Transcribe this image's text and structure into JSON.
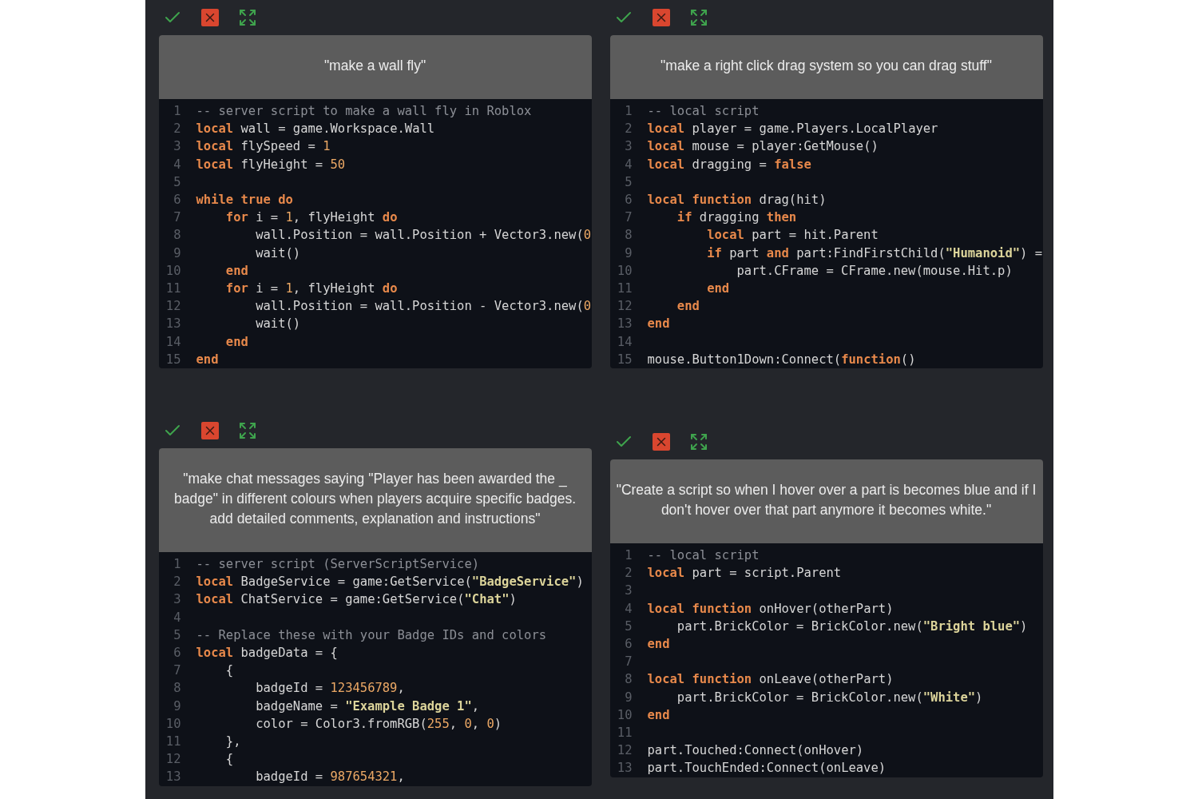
{
  "cards": [
    {
      "prompt": "\"make a wall fly\"",
      "lines": [
        {
          "number": "1",
          "tokens": [
            {
              "kind": "comment",
              "text": "-- server script to make a wall fly in Roblox"
            }
          ]
        },
        {
          "number": "2",
          "tokens": [
            {
              "kind": "keyword",
              "text": "local"
            },
            {
              "kind": "plain",
              "text": " wall = game.Workspace.Wall"
            }
          ]
        },
        {
          "number": "3",
          "tokens": [
            {
              "kind": "keyword",
              "text": "local"
            },
            {
              "kind": "plain",
              "text": " flySpeed = "
            },
            {
              "kind": "number",
              "text": "1"
            }
          ]
        },
        {
          "number": "4",
          "tokens": [
            {
              "kind": "keyword",
              "text": "local"
            },
            {
              "kind": "plain",
              "text": " flyHeight = "
            },
            {
              "kind": "number",
              "text": "50"
            }
          ]
        },
        {
          "number": "5"
        },
        {
          "number": "6",
          "tokens": [
            {
              "kind": "keyword",
              "text": "while true do"
            }
          ],
          "children": [
            {
              "number": "7",
              "tokens": [
                {
                  "kind": "keyword",
                  "text": "for"
                },
                {
                  "kind": "plain",
                  "text": " i = "
                },
                {
                  "kind": "number",
                  "text": "1"
                },
                {
                  "kind": "plain",
                  "text": ", flyHeight "
                },
                {
                  "kind": "keyword",
                  "text": "do"
                }
              ],
              "children": [
                {
                  "number": "8",
                  "tokens": [
                    {
                      "kind": "plain",
                      "text": "wall.Position = wall.Position + Vector3.new("
                    },
                    {
                      "kind": "number",
                      "text": "0"
                    }
                  ]
                },
                {
                  "number": "9",
                  "tokens": [
                    {
                      "kind": "plain",
                      "text": "wait()"
                    }
                  ]
                }
              ]
            },
            {
              "number": "10",
              "tokens": [
                {
                  "kind": "keyword",
                  "text": "end"
                }
              ]
            },
            {
              "number": "11",
              "tokens": [
                {
                  "kind": "keyword",
                  "text": "for"
                },
                {
                  "kind": "plain",
                  "text": " i = "
                },
                {
                  "kind": "number",
                  "text": "1"
                },
                {
                  "kind": "plain",
                  "text": ", flyHeight "
                },
                {
                  "kind": "keyword",
                  "text": "do"
                }
              ],
              "children": [
                {
                  "number": "12",
                  "tokens": [
                    {
                      "kind": "plain",
                      "text": "wall.Position = wall.Position - Vector3.new("
                    },
                    {
                      "kind": "number",
                      "text": "0"
                    }
                  ]
                },
                {
                  "number": "13",
                  "tokens": [
                    {
                      "kind": "plain",
                      "text": "wait()"
                    }
                  ]
                }
              ]
            },
            {
              "number": "14",
              "tokens": [
                {
                  "kind": "keyword",
                  "text": "end"
                }
              ]
            }
          ]
        },
        {
          "number": "15",
          "tokens": [
            {
              "kind": "keyword",
              "text": "end"
            }
          ]
        }
      ]
    },
    {
      "prompt": "\"make a right click drag system so you can drag stuff\"",
      "lines": [
        {
          "number": "1",
          "tokens": [
            {
              "kind": "comment",
              "text": "-- local script"
            }
          ]
        },
        {
          "number": "2",
          "tokens": [
            {
              "kind": "keyword",
              "text": "local"
            },
            {
              "kind": "plain",
              "text": " player = game.Players.LocalPlayer"
            }
          ]
        },
        {
          "number": "3",
          "tokens": [
            {
              "kind": "keyword",
              "text": "local"
            },
            {
              "kind": "plain",
              "text": " mouse = player:GetMouse()"
            }
          ]
        },
        {
          "number": "4",
          "tokens": [
            {
              "kind": "keyword",
              "text": "local"
            },
            {
              "kind": "plain",
              "text": " dragging = "
            },
            {
              "kind": "keyword",
              "text": "false"
            }
          ]
        },
        {
          "number": "5"
        },
        {
          "number": "6",
          "tokens": [
            {
              "kind": "keyword",
              "text": "local function"
            },
            {
              "kind": "plain",
              "text": " drag(hit)"
            }
          ],
          "children": [
            {
              "number": "7",
              "tokens": [
                {
                  "kind": "keyword",
                  "text": "if"
                },
                {
                  "kind": "plain",
                  "text": " dragging "
                },
                {
                  "kind": "keyword",
                  "text": "then"
                }
              ],
              "children": [
                {
                  "number": "8",
                  "tokens": [
                    {
                      "kind": "keyword",
                      "text": "local"
                    },
                    {
                      "kind": "plain",
                      "text": " part = hit.Parent"
                    }
                  ]
                },
                {
                  "number": "9",
                  "tokens": [
                    {
                      "kind": "keyword",
                      "text": "if"
                    },
                    {
                      "kind": "plain",
                      "text": " part "
                    },
                    {
                      "kind": "keyword",
                      "text": "and"
                    },
                    {
                      "kind": "plain",
                      "text": " part:FindFirstChild("
                    },
                    {
                      "kind": "string",
                      "text": "\"Humanoid\""
                    },
                    {
                      "kind": "plain",
                      "text": ") ="
                    }
                  ],
                  "children": [
                    {
                      "number": "10",
                      "tokens": [
                        {
                          "kind": "plain",
                          "text": "part.CFrame = CFrame.new(mouse.Hit.p)"
                        }
                      ]
                    }
                  ]
                },
                {
                  "number": "11",
                  "tokens": [
                    {
                      "kind": "keyword",
                      "text": "end"
                    }
                  ]
                }
              ]
            },
            {
              "number": "12",
              "tokens": [
                {
                  "kind": "keyword",
                  "text": "end"
                }
              ]
            }
          ]
        },
        {
          "number": "13",
          "tokens": [
            {
              "kind": "keyword",
              "text": "end"
            }
          ]
        },
        {
          "number": "14"
        },
        {
          "number": "15",
          "tokens": [
            {
              "kind": "plain",
              "text": "mouse.Button1Down:Connect("
            },
            {
              "kind": "keyword",
              "text": "function"
            },
            {
              "kind": "plain",
              "text": "()"
            }
          ]
        }
      ]
    },
    {
      "prompt": "\"make chat messages saying \"Player has been awarded the _ badge\" in different colours when players acquire specific badges. add detailed comments, explanation and instructions\"",
      "lines": [
        {
          "number": "1",
          "tokens": [
            {
              "kind": "comment",
              "text": "-- server script (ServerScriptService)"
            }
          ]
        },
        {
          "number": "2",
          "tokens": [
            {
              "kind": "keyword",
              "text": "local"
            },
            {
              "kind": "plain",
              "text": " BadgeService = game:GetService("
            },
            {
              "kind": "string",
              "text": "\"BadgeService\""
            },
            {
              "kind": "plain",
              "text": ")"
            }
          ]
        },
        {
          "number": "3",
          "tokens": [
            {
              "kind": "keyword",
              "text": "local"
            },
            {
              "kind": "plain",
              "text": " ChatService = game:GetService("
            },
            {
              "kind": "string",
              "text": "\"Chat\""
            },
            {
              "kind": "plain",
              "text": ")"
            }
          ]
        },
        {
          "number": "4"
        },
        {
          "number": "5",
          "tokens": [
            {
              "kind": "comment",
              "text": "-- Replace these with your Badge IDs and colors"
            }
          ]
        },
        {
          "number": "6",
          "tokens": [
            {
              "kind": "keyword",
              "text": "local"
            },
            {
              "kind": "plain",
              "text": " badgeData = {"
            }
          ],
          "children": [
            {
              "number": "7",
              "tokens": [
                {
                  "kind": "plain",
                  "text": "{"
                }
              ],
              "children": [
                {
                  "number": "8",
                  "tokens": [
                    {
                      "kind": "plain",
                      "text": "badgeId = "
                    },
                    {
                      "kind": "number",
                      "text": "123456789"
                    },
                    {
                      "kind": "plain",
                      "text": ","
                    }
                  ]
                },
                {
                  "number": "9",
                  "tokens": [
                    {
                      "kind": "plain",
                      "text": "badgeName = "
                    },
                    {
                      "kind": "string",
                      "text": "\"Example Badge 1\""
                    },
                    {
                      "kind": "plain",
                      "text": ","
                    }
                  ]
                },
                {
                  "number": "10",
                  "tokens": [
                    {
                      "kind": "plain",
                      "text": "color = Color3.fromRGB("
                    },
                    {
                      "kind": "number",
                      "text": "255"
                    },
                    {
                      "kind": "plain",
                      "text": ", "
                    },
                    {
                      "kind": "number",
                      "text": "0"
                    },
                    {
                      "kind": "plain",
                      "text": ", "
                    },
                    {
                      "kind": "number",
                      "text": "0"
                    },
                    {
                      "kind": "plain",
                      "text": ")"
                    }
                  ]
                }
              ]
            },
            {
              "number": "11",
              "tokens": [
                {
                  "kind": "plain",
                  "text": "},"
                }
              ]
            },
            {
              "number": "12",
              "tokens": [
                {
                  "kind": "plain",
                  "text": "{"
                }
              ],
              "children": [
                {
                  "number": "13",
                  "tokens": [
                    {
                      "kind": "plain",
                      "text": "badgeId = "
                    },
                    {
                      "kind": "number",
                      "text": "987654321"
                    },
                    {
                      "kind": "plain",
                      "text": ","
                    }
                  ]
                }
              ]
            }
          ]
        }
      ]
    },
    {
      "prompt": "\"Create a script so when I hover over a part is becomes blue and if I don't hover over that part anymore it becomes white.\"",
      "lines": [
        {
          "number": "1",
          "tokens": [
            {
              "kind": "comment",
              "text": "-- local script"
            }
          ]
        },
        {
          "number": "2",
          "tokens": [
            {
              "kind": "keyword",
              "text": "local"
            },
            {
              "kind": "plain",
              "text": " part = script.Parent"
            }
          ]
        },
        {
          "number": "3"
        },
        {
          "number": "4",
          "tokens": [
            {
              "kind": "keyword",
              "text": "local function"
            },
            {
              "kind": "plain",
              "text": " onHover(otherPart)"
            }
          ],
          "children": [
            {
              "number": "5",
              "tokens": [
                {
                  "kind": "plain",
                  "text": "part.BrickColor = BrickColor.new("
                },
                {
                  "kind": "string",
                  "text": "\"Bright blue\""
                },
                {
                  "kind": "plain",
                  "text": ")"
                }
              ]
            }
          ]
        },
        {
          "number": "6",
          "tokens": [
            {
              "kind": "keyword",
              "text": "end"
            }
          ]
        },
        {
          "number": "7"
        },
        {
          "number": "8",
          "tokens": [
            {
              "kind": "keyword",
              "text": "local function"
            },
            {
              "kind": "plain",
              "text": " onLeave(otherPart)"
            }
          ],
          "children": [
            {
              "number": "9",
              "tokens": [
                {
                  "kind": "plain",
                  "text": "part.BrickColor = BrickColor.new("
                },
                {
                  "kind": "string",
                  "text": "\"White\""
                },
                {
                  "kind": "plain",
                  "text": ")"
                }
              ]
            }
          ]
        },
        {
          "number": "10",
          "tokens": [
            {
              "kind": "keyword",
              "text": "end"
            }
          ]
        },
        {
          "number": "11"
        },
        {
          "number": "12",
          "tokens": [
            {
              "kind": "plain",
              "text": "part.Touched:Connect(onHover)"
            }
          ]
        },
        {
          "number": "13",
          "tokens": [
            {
              "kind": "plain",
              "text": "part.TouchEnded:Connect(onLeave)"
            }
          ]
        }
      ]
    }
  ]
}
